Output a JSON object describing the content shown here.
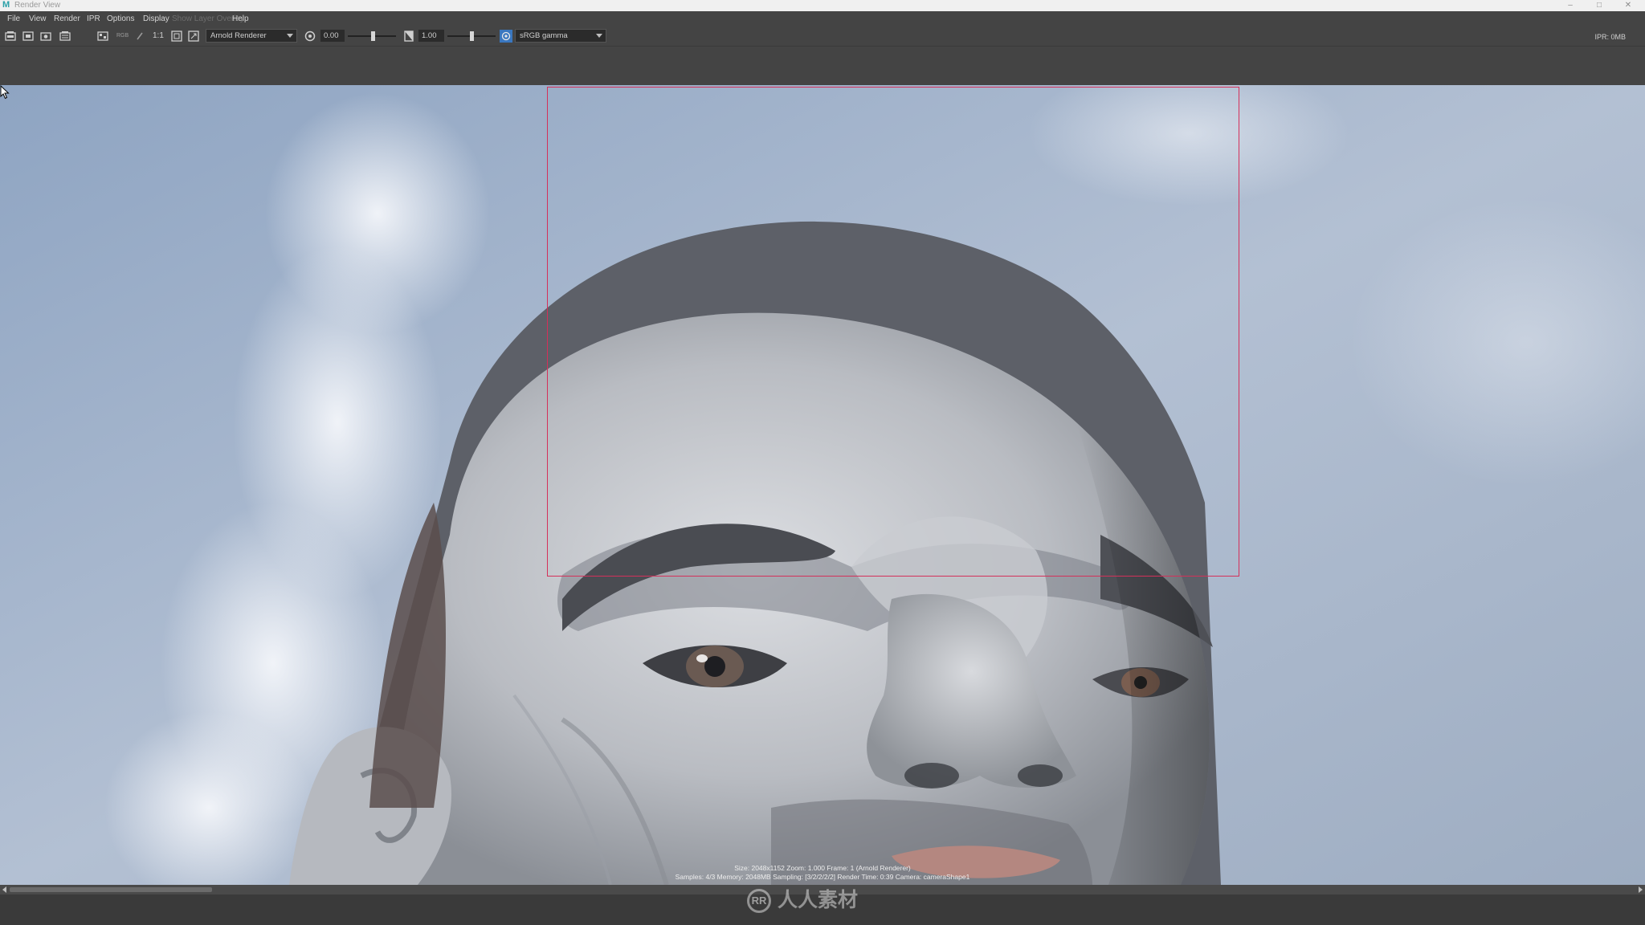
{
  "window": {
    "title": "Render View",
    "app_icon": "maya-icon"
  },
  "menu": {
    "items": [
      "File",
      "View",
      "Render",
      "IPR",
      "Options",
      "Display",
      "Help"
    ],
    "disabled_item": "Show Layer Overlay"
  },
  "toolbar": {
    "ratio_label": "1:1",
    "rgb_label": "RGB",
    "renderer": "Arnold Renderer",
    "exposure": "0.00",
    "gamma": "1.00",
    "colorspace": "sRGB gamma",
    "ipr_memory": "IPR: 0MB",
    "icons": [
      "redo-render-icon",
      "render-region-icon",
      "snapshot-icon",
      "ipr-render-icon",
      "display-channels-icon",
      "rgb-channels-icon",
      "refresh-icon",
      "real-size-icon",
      "frame-image-icon",
      "frame-region-icon",
      "exposure-reset-icon",
      "gamma-reset-icon",
      "color-management-icon"
    ]
  },
  "viewport": {
    "render_stats_line1": "Size: 2048x1152  Zoom: 1.000  Frame: 1  (Arnold Renderer)",
    "render_stats_line2": "Samples: 4/3  Memory: 2048MB  Sampling: [3/2/2/2/2]  Render Time: 0:39  Camera: cameraShape1",
    "colors": {
      "region_border": "#d4305a",
      "sky": "#8fa3bd"
    }
  },
  "watermark": {
    "text": "人人素材"
  }
}
